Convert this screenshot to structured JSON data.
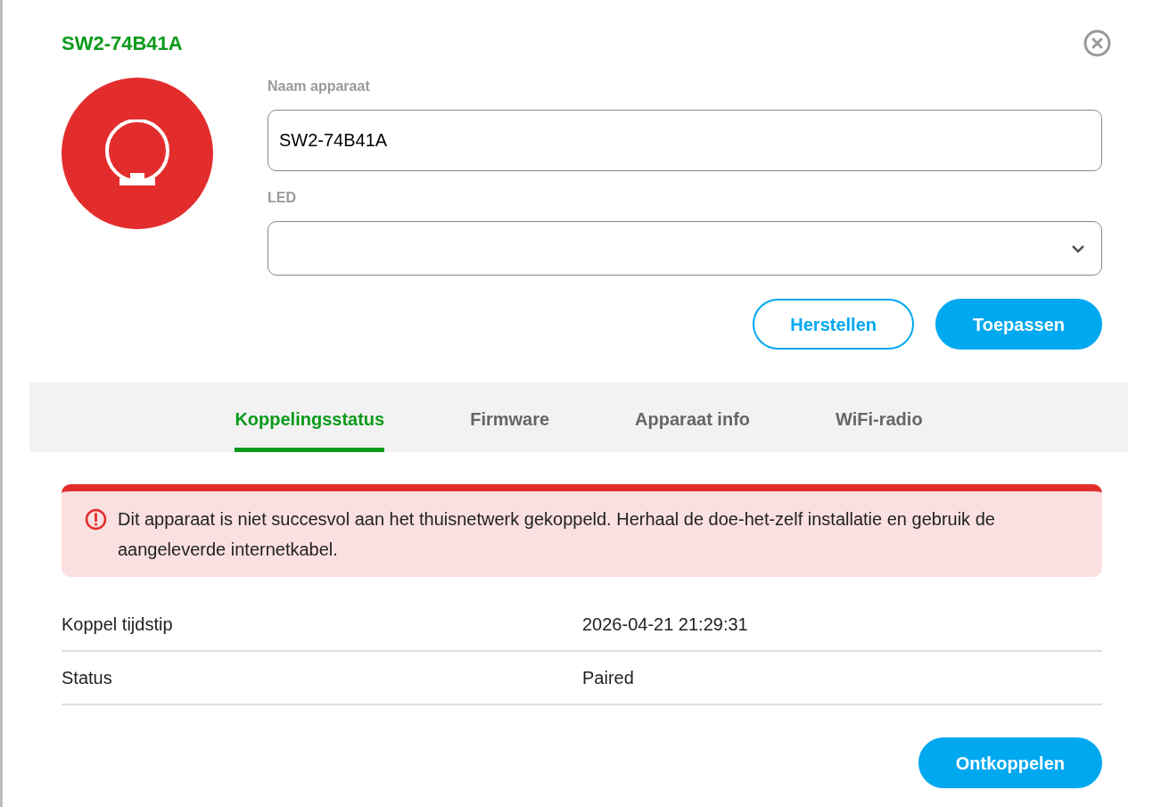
{
  "dialog": {
    "title": "SW2-74B41A"
  },
  "form": {
    "name_label": "Naam apparaat",
    "name_value": "SW2-74B41A",
    "led_label": "LED",
    "buttons": [
      {
        "label": "Herstellen",
        "kind": "outline"
      },
      {
        "label": "Toepassen",
        "kind": "primary"
      }
    ]
  },
  "tabs": [
    {
      "label": "Koppelingsstatus",
      "selected": true
    },
    {
      "label": "Firmware",
      "selected": false
    },
    {
      "label": "Apparaat info",
      "selected": false
    },
    {
      "label": "WiFi-radio",
      "selected": false
    }
  ],
  "alert": {
    "text": "Dit apparaat is niet succesvol aan het thuisnetwerk gekoppeld. Herhaal de doe-het-zelf installatie en gebruik de aangeleverde internetkabel."
  },
  "details": [
    {
      "label": "Koppel tijdstip",
      "value": "2026-04-21 21:29:31"
    },
    {
      "label": "Status",
      "value": "Paired"
    }
  ],
  "footer_button": "Ontkoppelen"
}
